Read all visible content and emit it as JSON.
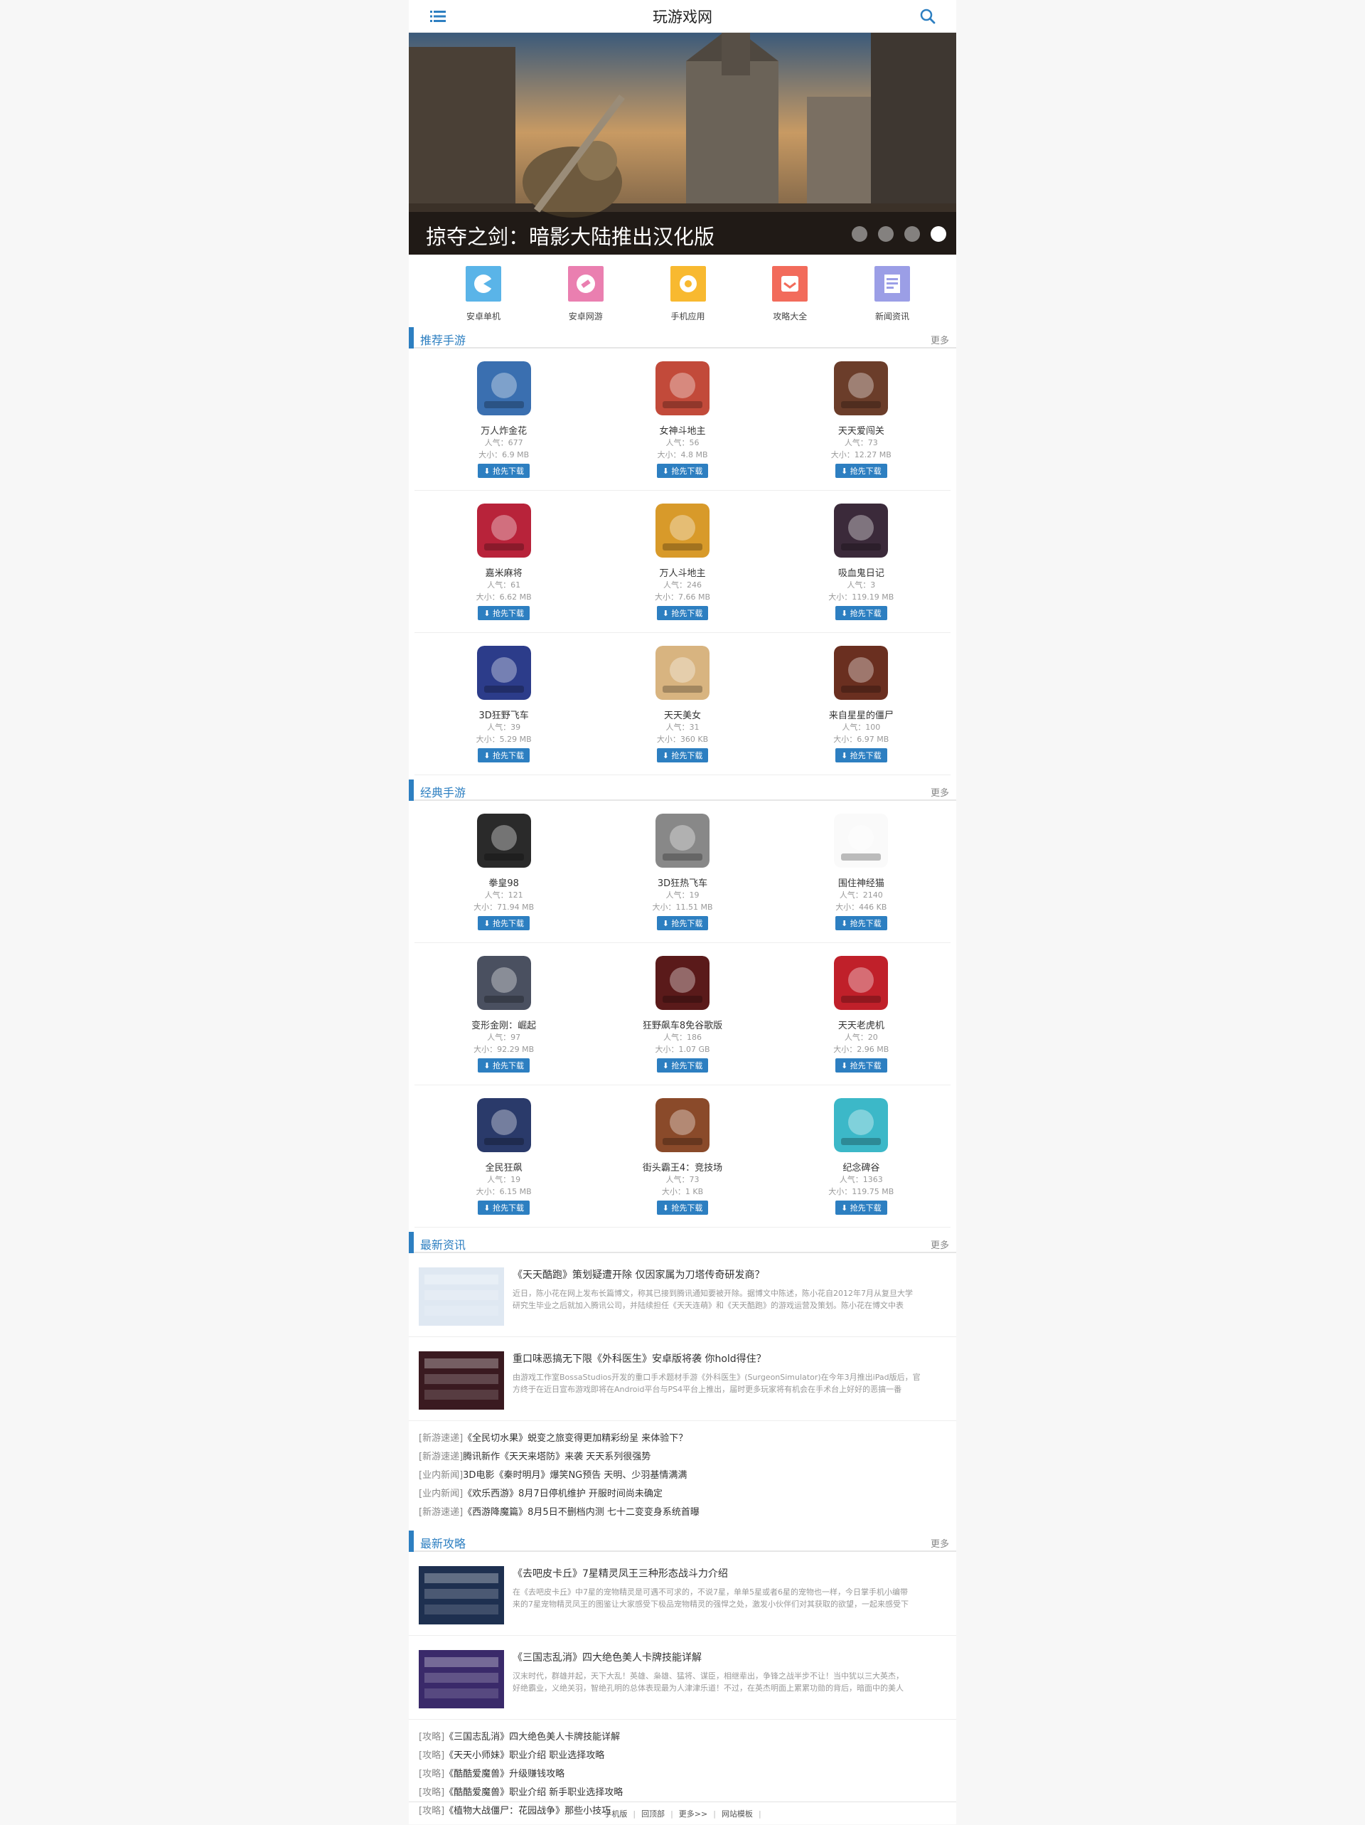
{
  "header": {
    "title": "玩游戏网"
  },
  "banner": {
    "title": "掠夺之剑：暗影大陆推出汉化版",
    "slide_count": 4,
    "active_slide": 4
  },
  "quick_nav": [
    {
      "label": "安卓单机",
      "icon": "pacman-icon",
      "color": "#5ab4e8"
    },
    {
      "label": "安卓网游",
      "icon": "tag-icon",
      "color": "#ea7fb0"
    },
    {
      "label": "手机应用",
      "icon": "gear-icon",
      "color": "#f8b930"
    },
    {
      "label": "攻略大全",
      "icon": "inbox-icon",
      "color": "#f26b5b"
    },
    {
      "label": "新闻资讯",
      "icon": "document-icon",
      "color": "#9b9ee6"
    }
  ],
  "sections": {
    "recommended": {
      "title": "推荐手游",
      "more": "更多"
    },
    "classic": {
      "title": "经典手游",
      "more": "更多"
    },
    "news": {
      "title": "最新资讯",
      "more": "更多"
    },
    "guides": {
      "title": "最新攻略",
      "more": "更多"
    }
  },
  "recommended_games": [
    {
      "name": "万人炸金花",
      "pop": "人气：677",
      "size": "大小：6.9 MB",
      "btn": "抢先下载"
    },
    {
      "name": "女神斗地主",
      "pop": "人气：56",
      "size": "大小：4.8 MB",
      "btn": "抢先下载"
    },
    {
      "name": "天天爱闯关",
      "pop": "人气：73",
      "size": "大小：12.27 MB",
      "btn": "抢先下载"
    },
    {
      "name": "嘉米麻将",
      "pop": "人气：61",
      "size": "大小：6.62 MB",
      "btn": "抢先下载"
    },
    {
      "name": "万人斗地主",
      "pop": "人气：246",
      "size": "大小：7.66 MB",
      "btn": "抢先下载"
    },
    {
      "name": "吸血鬼日记",
      "pop": "人气：3",
      "size": "大小：119.19 MB",
      "btn": "抢先下载"
    },
    {
      "name": "3D狂野飞车",
      "pop": "人气：39",
      "size": "大小：5.29 MB",
      "btn": "抢先下载"
    },
    {
      "name": "天天美女",
      "pop": "人气：31",
      "size": "大小：360 KB",
      "btn": "抢先下载"
    },
    {
      "name": "来自星星的僵尸",
      "pop": "人气：100",
      "size": "大小：6.97 MB",
      "btn": "抢先下载"
    }
  ],
  "classic_games": [
    {
      "name": "拳皇98",
      "pop": "人气：121",
      "size": "大小：71.94 MB",
      "btn": "抢先下载"
    },
    {
      "name": "3D狂热飞车",
      "pop": "人气：19",
      "size": "大小：11.51 MB",
      "btn": "抢先下载"
    },
    {
      "name": "围住神经猫",
      "pop": "人气：2140",
      "size": "大小：446 KB",
      "btn": "抢先下载"
    },
    {
      "name": "变形金刚：崛起",
      "pop": "人气：97",
      "size": "大小：92.29 MB",
      "btn": "抢先下载"
    },
    {
      "name": "狂野飙车8免谷歌版",
      "pop": "人气：186",
      "size": "大小：1.07 GB",
      "btn": "抢先下载"
    },
    {
      "name": "天天老虎机",
      "pop": "人气：20",
      "size": "大小：2.96 MB",
      "btn": "抢先下载"
    },
    {
      "name": "全民狂飙",
      "pop": "人气：19",
      "size": "大小：6.15 MB",
      "btn": "抢先下载"
    },
    {
      "name": "街头霸王4：竞技场",
      "pop": "人气：73",
      "size": "大小：1 KB",
      "btn": "抢先下载"
    },
    {
      "name": "纪念碑谷",
      "pop": "人气：1363",
      "size": "大小：119.75 MB",
      "btn": "抢先下载"
    }
  ],
  "news_featured": [
    {
      "title": "《天天酷跑》策划疑遭开除 仅因家属为刀塔传奇研发商？",
      "desc1": "近日，陈小花在网上发布长篇博文，称其已接到腾讯通知要被开除。据博文中陈述，陈小花自2012年7月从复旦大学",
      "desc2": "研究生毕业之后就加入腾讯公司，并陆续担任《天天连萌》和《天天酷跑》的游戏运营及策划。陈小花在博文中表"
    },
    {
      "title": "重口味恶搞无下限《外科医生》安卓版将袭 你hold得住？",
      "desc1": "由游戏工作室BossaStudios开发的重口手术题材手游《外科医生》(SurgeonSimulator)在今年3月推出iPad版后，官",
      "desc2": "方终于在近日宣布游戏即将在Android平台与PS4平台上推出，届时更多玩家将有机会在手术台上好好的恶搞一番"
    }
  ],
  "news_list": [
    {
      "tag": "[新游速递]",
      "text": "《全民切水果》蜕变之旅变得更加精彩纷呈 来体验下？"
    },
    {
      "tag": "[新游速递]",
      "text": "腾讯新作《天天来塔防》来袭 天天系列很强势"
    },
    {
      "tag": "[业内新闻]",
      "text": "3D电影《秦时明月》爆笑NG预告 天明、少羽基情满满"
    },
    {
      "tag": "[业内新闻]",
      "text": "《欢乐西游》8月7日停机维护 开服时间尚未确定"
    },
    {
      "tag": "[新游速递]",
      "text": "《西游降魔篇》8月5日不删档内测 七十二变变身系统首曝"
    }
  ],
  "guides_featured": [
    {
      "title": "《去吧皮卡丘》7星精灵凤王三种形态战斗力介绍",
      "desc1": "在《去吧皮卡丘》中7星的宠物精灵是可遇不可求的，不说7星，单单5星或者6星的宠物也一样，今日掌手机小编带",
      "desc2": "来的7星宠物精灵凤王的图鉴让大家感受下极品宠物精灵的强悍之处，激发小伙伴们对其获取的欲望，一起来感受下"
    },
    {
      "title": "《三国志乱消》四大绝色美人卡牌技能详解",
      "desc1": "汉末时代，群雄并起，天下大乱！英雄、枭雄、猛将、谋臣，相继辈出，争锋之战半步不让！当中犹以三大英杰，",
      "desc2": "好绝霸业，义绝关羽，智绝孔明的总体表现最为人津津乐道！不过，在英杰明面上累累功勋的背后，暗面中的美人"
    }
  ],
  "guides_list": [
    {
      "tag": "[攻略]",
      "text": "《三国志乱消》四大绝色美人卡牌技能详解"
    },
    {
      "tag": "[攻略]",
      "text": "《天天小师妹》职业介绍 职业选择攻略"
    },
    {
      "tag": "[攻略]",
      "text": "《酷酷爱魔兽》升级赚钱攻略"
    },
    {
      "tag": "[攻略]",
      "text": "《酷酷爱魔兽》职业介绍 新手职业选择攻略"
    },
    {
      "tag": "[攻略]",
      "text": "《植物大战僵尸：花园战争》那些小技巧"
    }
  ],
  "footer": {
    "links": [
      "手机版",
      "回顶部",
      "更多>>",
      "网站模板"
    ],
    "sep": "|"
  }
}
